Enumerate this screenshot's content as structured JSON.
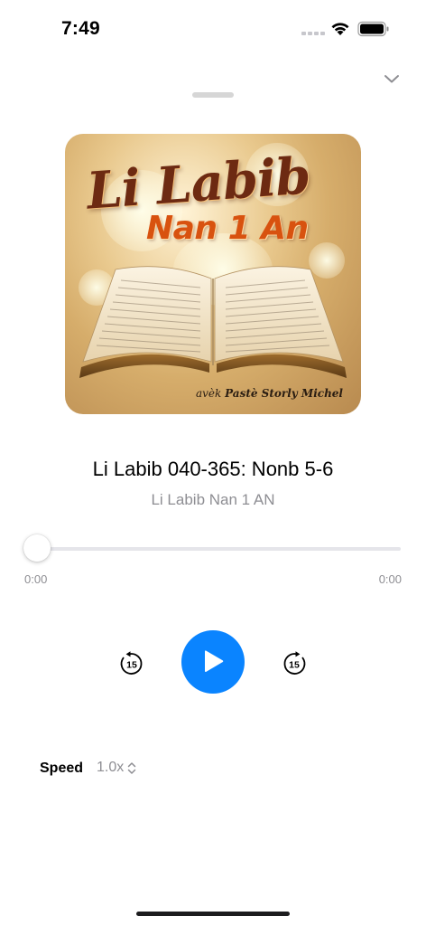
{
  "status_bar": {
    "time": "7:49"
  },
  "artwork": {
    "title_line1": "Li Labib",
    "title_line2": "Nan 1 An",
    "credit_prefix": "avèk",
    "credit_name": "Pastè Storly Michel"
  },
  "player": {
    "track_title": "Li Labib 040-365: Nonb 5-6",
    "album_title": "Li Labib Nan 1 AN",
    "elapsed": "0:00",
    "remaining": "0:00",
    "progress": 0,
    "skip_back_seconds": "15",
    "skip_forward_seconds": "15",
    "state": "paused"
  },
  "speed": {
    "label": "Speed",
    "value": "1.0x"
  },
  "colors": {
    "accent": "#0a84ff",
    "secondary_text": "#8e8e93"
  },
  "icons": {
    "collapse": "chevron-down-icon",
    "play": "play-icon",
    "skip_back": "skip-back-15-icon",
    "skip_forward": "skip-forward-15-icon",
    "speed": "up-down-chevron-icon"
  }
}
